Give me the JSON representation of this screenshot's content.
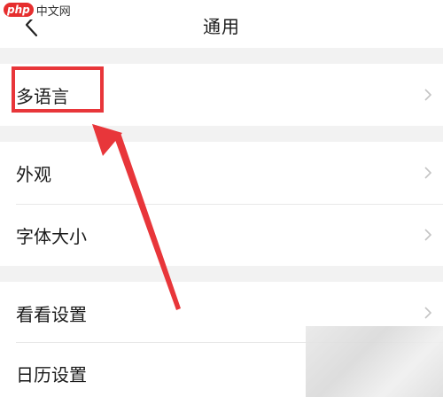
{
  "header": {
    "title": "通用",
    "back_icon": "chevron-left-icon"
  },
  "watermark": {
    "brand_short": "php",
    "brand_text": "中文网"
  },
  "groups": [
    {
      "items": [
        {
          "label": "多语言"
        }
      ]
    },
    {
      "items": [
        {
          "label": "外观"
        },
        {
          "label": "字体大小"
        }
      ]
    },
    {
      "items": [
        {
          "label": "看看设置"
        },
        {
          "label": "日历设置"
        }
      ]
    }
  ],
  "colors": {
    "highlight": "#e8363a",
    "background": "#f2f2f2",
    "row_background": "#ffffff"
  }
}
